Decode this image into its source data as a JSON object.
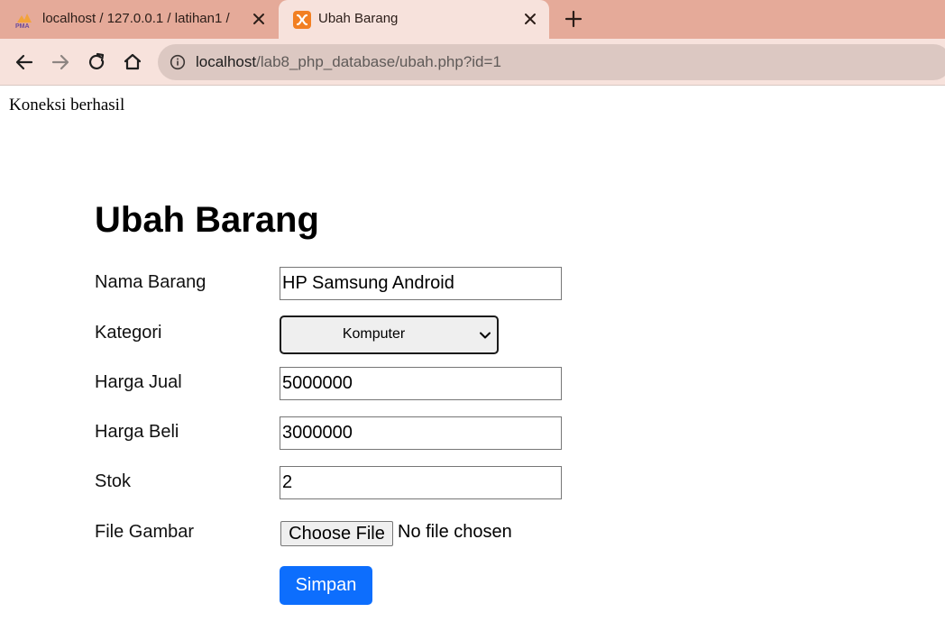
{
  "browser": {
    "tabs": [
      {
        "title": "localhost / 127.0.0.1 / latihan1 /",
        "icon": "phpmyadmin-icon",
        "active": false
      },
      {
        "title": "Ubah Barang",
        "icon": "xampp-icon",
        "active": true
      }
    ],
    "url_host": "localhost",
    "url_path": "/lab8_php_database/ubah.php?id=1",
    "colors": {
      "tabstrip": "#e5aa99",
      "active_tab": "#f7e2dc",
      "omnibox": "#dcc8c2"
    }
  },
  "page": {
    "status_text": "Koneksi berhasil",
    "heading": "Ubah Barang",
    "form": {
      "nama_label": "Nama Barang",
      "nama_value": "HP Samsung Android",
      "kategori_label": "Kategori",
      "kategori_value": "Komputer",
      "harga_jual_label": "Harga Jual",
      "harga_jual_value": "5000000",
      "harga_beli_label": "Harga Beli",
      "harga_beli_value": "3000000",
      "stok_label": "Stok",
      "stok_value": "2",
      "file_label": "File Gambar",
      "file_button": "Choose File",
      "file_status": "No file chosen",
      "submit_label": "Simpan"
    },
    "colors": {
      "submit": "#0d6efd"
    }
  }
}
